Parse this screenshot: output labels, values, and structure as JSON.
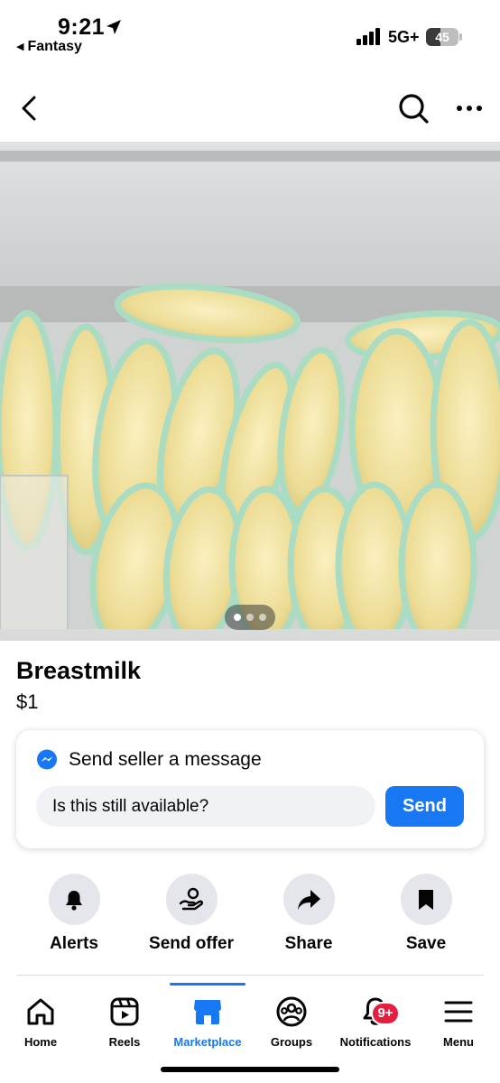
{
  "status_bar": {
    "time": "9:21",
    "back_app": "Fantasy",
    "network": "5G+",
    "battery": "45",
    "battery_level": 0.45
  },
  "nav": {
    "back_icon": "chevron-left-icon",
    "search_icon": "search-icon",
    "more_icon": "more-horizontal-icon"
  },
  "photo": {
    "page_count": 3,
    "current_page": 1
  },
  "listing": {
    "title": "Breastmilk",
    "price": "$1"
  },
  "message_card": {
    "heading": "Send seller a message",
    "input_value": "Is this still available?",
    "send_label": "Send"
  },
  "actions": [
    {
      "label": "Alerts",
      "icon": "bell-icon"
    },
    {
      "label": "Send offer",
      "icon": "offer-hand-icon"
    },
    {
      "label": "Share",
      "icon": "share-arrow-icon"
    },
    {
      "label": "Save",
      "icon": "bookmark-icon"
    }
  ],
  "tabs": [
    {
      "label": "Home",
      "icon": "home-icon",
      "active": false
    },
    {
      "label": "Reels",
      "icon": "reels-icon",
      "active": false
    },
    {
      "label": "Marketplace",
      "icon": "marketplace-icon",
      "active": true
    },
    {
      "label": "Groups",
      "icon": "groups-icon",
      "active": false
    },
    {
      "label": "Notifications",
      "icon": "bell-icon",
      "active": false,
      "badge": "9+"
    },
    {
      "label": "Menu",
      "icon": "menu-icon",
      "active": false
    }
  ],
  "colors": {
    "accent": "#1877f2",
    "badge": "#e41e3f",
    "surface_gray": "#e4e6eb",
    "input_gray": "#f0f2f5"
  }
}
